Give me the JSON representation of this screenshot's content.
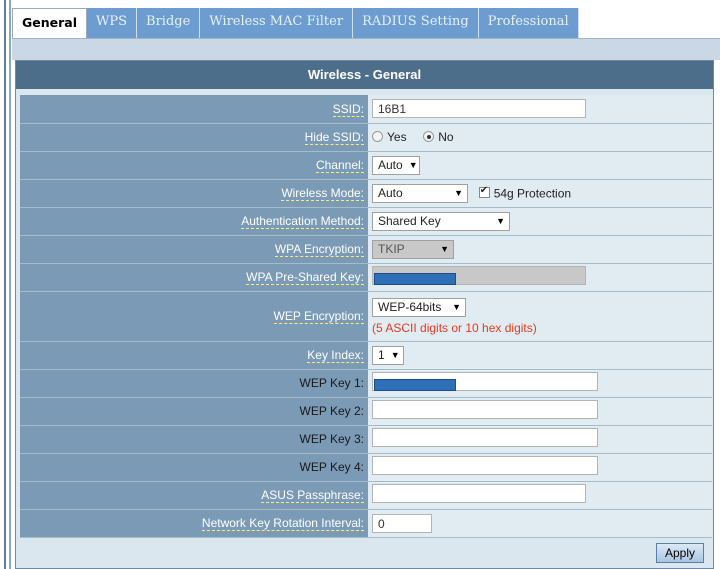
{
  "tabs": [
    {
      "label": "General"
    },
    {
      "label": "WPS"
    },
    {
      "label": "Bridge"
    },
    {
      "label": "Wireless MAC Filter"
    },
    {
      "label": "RADIUS Setting"
    },
    {
      "label": "Professional"
    }
  ],
  "header": {
    "title": "Wireless - General"
  },
  "form": {
    "ssid": {
      "label": "SSID:",
      "value": "16B1"
    },
    "hide_ssid": {
      "label": "Hide SSID:",
      "opt_yes": "Yes",
      "opt_no": "No",
      "selected": "No"
    },
    "channel": {
      "label": "Channel:",
      "value": "Auto"
    },
    "wireless_mode": {
      "label": "Wireless Mode:",
      "value": "Auto",
      "protection_label": "54g Protection",
      "protection_checked": true
    },
    "auth_method": {
      "label": "Authentication Method:",
      "value": "Shared Key"
    },
    "wpa_encryption": {
      "label": "WPA Encryption:",
      "value": "TKIP"
    },
    "wpa_psk": {
      "label": "WPA Pre-Shared Key:"
    },
    "wep_encryption": {
      "label": "WEP Encryption:",
      "value": "WEP-64bits",
      "hint": "(5 ASCII digits or 10 hex digits)"
    },
    "key_index": {
      "label": "Key Index:",
      "value": "1"
    },
    "wep_key1": {
      "label": "WEP Key 1:"
    },
    "wep_key2": {
      "label": "WEP Key 2:",
      "value": ""
    },
    "wep_key3": {
      "label": "WEP Key 3:",
      "value": ""
    },
    "wep_key4": {
      "label": "WEP Key 4:",
      "value": ""
    },
    "asus_passphrase": {
      "label": "ASUS Passphrase:",
      "value": ""
    },
    "rotation_interval": {
      "label": "Network Key Rotation Interval:",
      "value": "0"
    }
  },
  "actions": {
    "apply_label": "Apply"
  },
  "colors": {
    "tab": "#6d9dd0",
    "header": "#4d6e8b",
    "label_cell": "#7a9ab6",
    "hint": "#e53a1e"
  }
}
